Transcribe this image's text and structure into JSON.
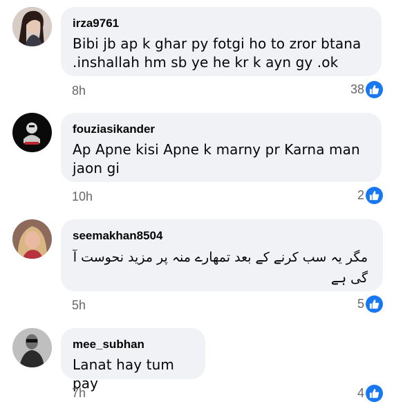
{
  "comments": [
    {
      "username": "irza9761",
      "text": "Bibi jb ap k ghar py fotgi ho to zror btana .inshallah hm sb ye he kr k ayn gy .ok",
      "time": "8h",
      "likes": "38",
      "avatar_icon": "profile-photo-woman"
    },
    {
      "username": "fouziasikander",
      "text": "Ap Apne kisi Apne k marny pr Karna man jaon gi",
      "time": "10h",
      "likes": "2",
      "avatar_icon": "profile-graphic-dark"
    },
    {
      "username": "seemakhan8504",
      "text": "مگر یہ سب کرنے کے بعد تمھارے منہ پر مزید نحوست آ گی ہے",
      "time": "5h",
      "likes": "5",
      "avatar_icon": "profile-photo-woman-blonde"
    },
    {
      "username": "mee_subhan",
      "text": "Lanat hay tum pay",
      "time": "7h",
      "likes": "4",
      "avatar_icon": "profile-photo-man"
    }
  ],
  "colors": {
    "bubble": "#f0f2f5",
    "meta": "#65676b",
    "like": "#1877f2"
  }
}
